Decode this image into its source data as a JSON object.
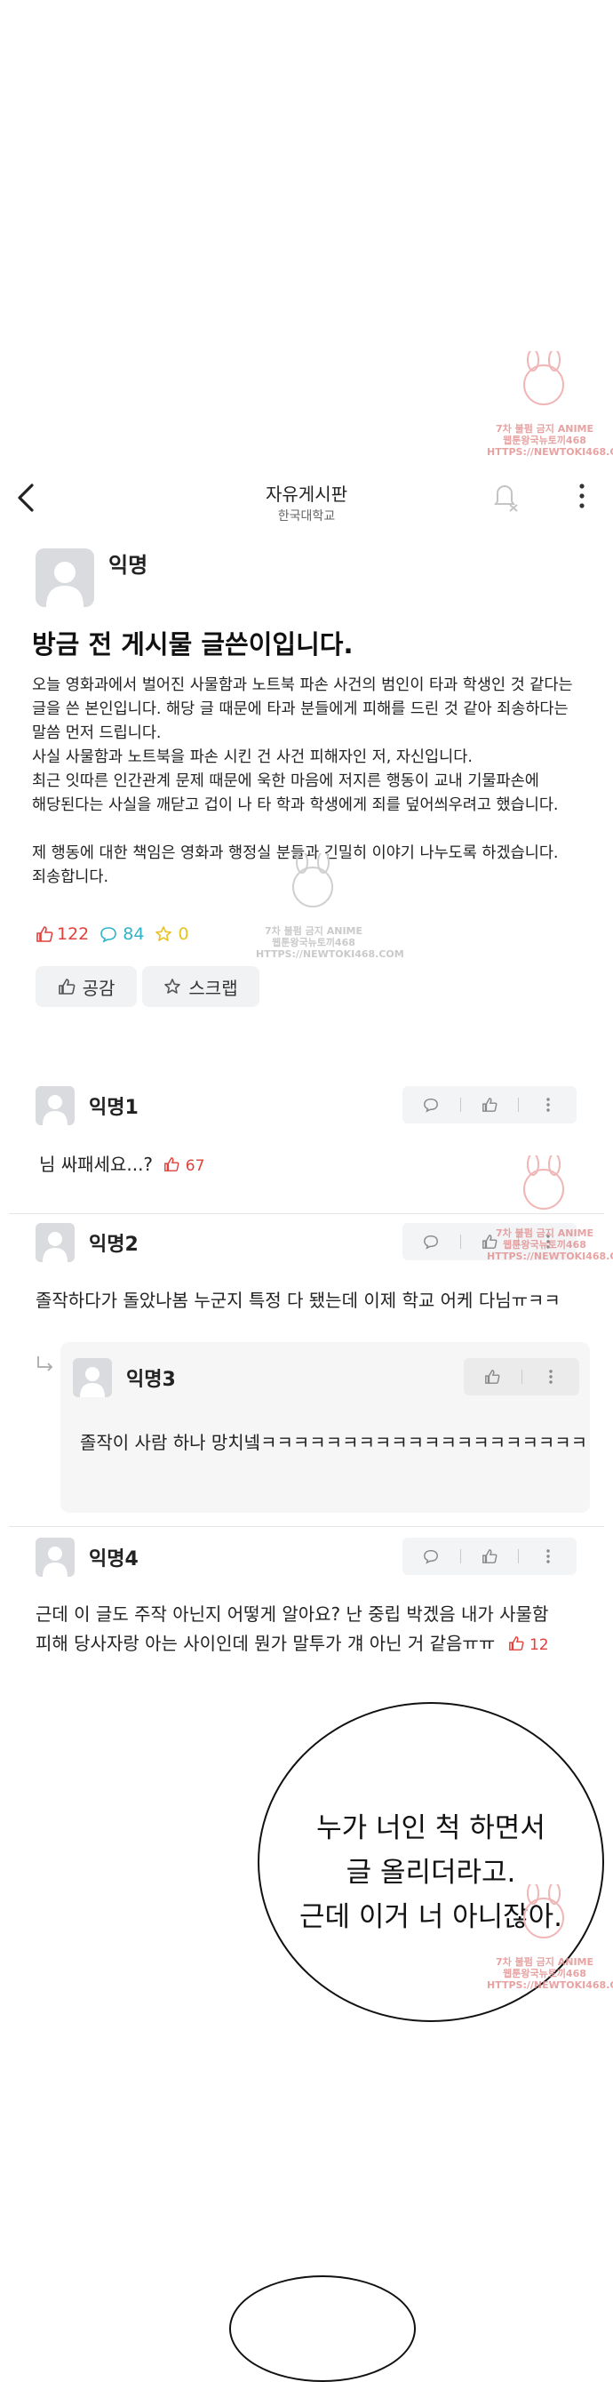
{
  "header": {
    "title": "자유게시판",
    "subtitle": "한국대학교"
  },
  "post": {
    "author": "익명",
    "title": "방금 전 게시물 글쓴이입니다.",
    "paragraphs": [
      "오늘 영화과에서 벌어진 사물함과 노트북 파손 사건의 범인이 타과 학생인 것 같다는\n글을 쓴 본인입니다. 해당 글 때문에 타과 분들에게 피해를 드린 것 같아 죄송하다는\n말씀 먼저 드립니다.\n사실 사물함과 노트북을 파손 시킨 건 사건 피해자인 저, 자신입니다.\n최근 잇따른 인간관계 문제 때문에 욱한 마음에 저지른 행동이 교내 기물파손에\n해당된다는 사실을 깨닫고 겁이 나 타 학과 학생에게 죄를 덮어씌우려고 했습니다.",
      "제 행동에 대한 책임은 영화과 행정실 분들과 긴밀히 이야기 나누도록 하겠습니다.\n죄송합니다."
    ],
    "likes": "122",
    "comments": "84",
    "scraps": "0",
    "like_button": "공감",
    "scrap_button": "스크랩"
  },
  "comments": [
    {
      "author": "익명1",
      "text": "님 싸패세요...?",
      "likes": "67"
    },
    {
      "author": "익명2",
      "text": "졸작하다가 돌았나봄 누군지 특정 다 됐는데 이제 학교 어케 다님ㅠㅋㅋ"
    },
    {
      "author": "익명3",
      "text": "졸작이 사람 하나 망치넼ㅋㅋㅋㅋㅋㅋㅋㅋㅋㅋㅋㅋㅋㅋㅋㅋㅋㅋㅋㅋ"
    },
    {
      "author": "익명4",
      "line1": "근데 이 글도 주작 아닌지 어떻게 알아요? 난 중립 박겠음 내가 사물함",
      "line2": "피해 당사자랑 아는 사이인데 뭔가 말투가 걔 아닌 거 같음ㅠㅠ",
      "likes": "12"
    }
  ],
  "bubble": {
    "line1": "누가 너인 척 하면서",
    "line2": "글 올리더라고.",
    "line3": "근데 이거 너 아니잖아."
  },
  "watermark": {
    "line1": "7차 불펌 금지 ANIME",
    "line2": "웹툰왕국뉴토끼468",
    "line3": "HTTPS://NEWTOKI468.COM"
  }
}
